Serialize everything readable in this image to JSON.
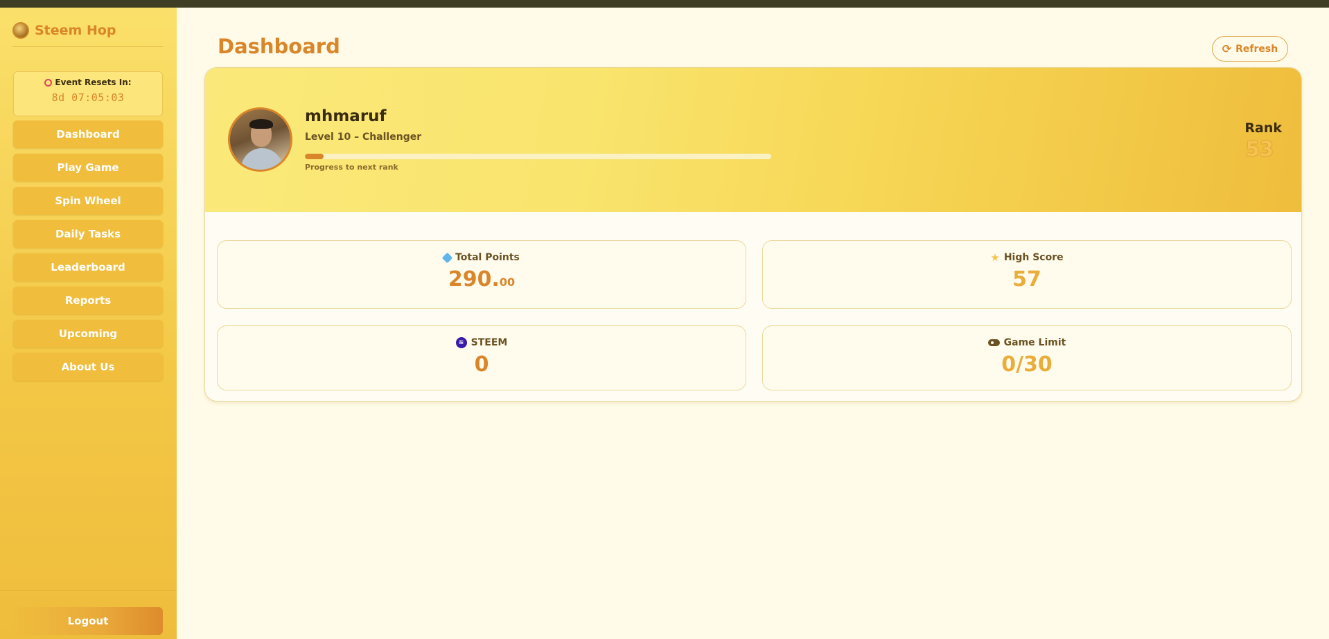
{
  "app": {
    "name": "Steem Hop"
  },
  "timer": {
    "label": "Event Resets In:",
    "value": "8d 07:05:03"
  },
  "nav": {
    "items": [
      {
        "label": "Dashboard"
      },
      {
        "label": "Play Game"
      },
      {
        "label": "Spin Wheel"
      },
      {
        "label": "Daily Tasks"
      },
      {
        "label": "Leaderboard"
      },
      {
        "label": "Reports"
      },
      {
        "label": "Upcoming"
      },
      {
        "label": "About Us"
      }
    ],
    "logout_label": "Logout"
  },
  "page": {
    "title": "Dashboard",
    "refresh_label": "Refresh"
  },
  "profile": {
    "username": "mhmaruf",
    "level": "Level 10 – Challenger",
    "progress_percent": 4,
    "progress_label": "Progress to next rank",
    "rank_label": "Rank",
    "rank_value": "53"
  },
  "stats": {
    "total_points": {
      "label": "Total Points",
      "value_int": "290.",
      "value_dec": "00",
      "color": "#d9862a"
    },
    "high_score": {
      "label": "High Score",
      "value": "57",
      "color": "#e9ad3a"
    },
    "steem": {
      "label": "STEEM",
      "value": "0",
      "color": "#d9862a"
    },
    "game_limit": {
      "label": "Game Limit",
      "value": "0/30",
      "color": "#e9ad3a"
    }
  },
  "colors": {
    "accent": "#d9862a",
    "sidebar": "#f0bd3d",
    "topbar": "#3f3d23"
  }
}
